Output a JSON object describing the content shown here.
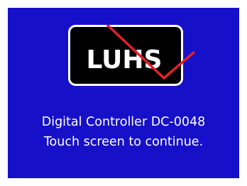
{
  "boot_screen": {
    "logo_text": "LUHS",
    "product_line": "Digital Controller DC-0048",
    "instruction": "Touch screen to continue."
  },
  "colors": {
    "background": "#1610c8",
    "logo_fill": "#000000",
    "logo_border": "#ffffff",
    "checkmark": "#e0202a",
    "text": "#ffffff"
  }
}
